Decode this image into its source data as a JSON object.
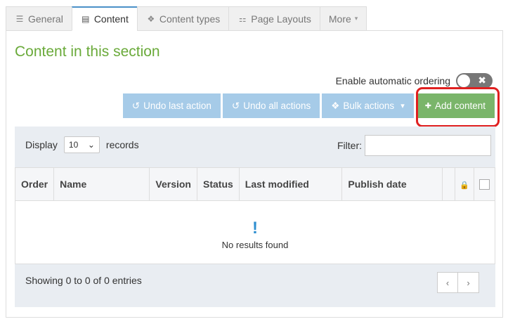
{
  "tabs": [
    {
      "label": "General",
      "icon": "sliders-icon",
      "glyph": "☰"
    },
    {
      "label": "Content",
      "icon": "document-icon",
      "glyph": "▤"
    },
    {
      "label": "Content types",
      "icon": "cubes-icon",
      "glyph": "❖"
    },
    {
      "label": "Page Layouts",
      "icon": "sitemap-icon",
      "glyph": "⚏"
    },
    {
      "label": "More",
      "icon": "caret-down-icon",
      "glyph": "▾"
    }
  ],
  "section": {
    "title": "Content in this section"
  },
  "ordering": {
    "label": "Enable automatic ordering",
    "enabled": false,
    "toggle_glyph": "✖"
  },
  "actions": {
    "undo_last": "Undo last action",
    "undo_all": "Undo all actions",
    "bulk": "Bulk actions",
    "add": "Add content",
    "undo_glyph": "↺",
    "bulk_glyph": "❖",
    "caret_glyph": "▾",
    "add_glyph": "✚"
  },
  "table": {
    "display_label": "Display",
    "page_size": "10",
    "select_glyph": "⌄",
    "records_label": "records",
    "filter_label": "Filter:",
    "filter_value": "",
    "columns": [
      "Order",
      "Name",
      "Version",
      "Status",
      "Last modified",
      "Publish date"
    ],
    "lock_glyph": "🔒",
    "empty_glyph": "!",
    "empty_message": "No results found",
    "info": "Showing 0 to 0 of 0 entries",
    "prev_glyph": "‹",
    "next_glyph": "›"
  },
  "colors": {
    "accent_green": "#6aaa3a",
    "button_blue": "#a6cbe8",
    "add_green": "#7ab56a",
    "annotation_red": "#e02020"
  }
}
